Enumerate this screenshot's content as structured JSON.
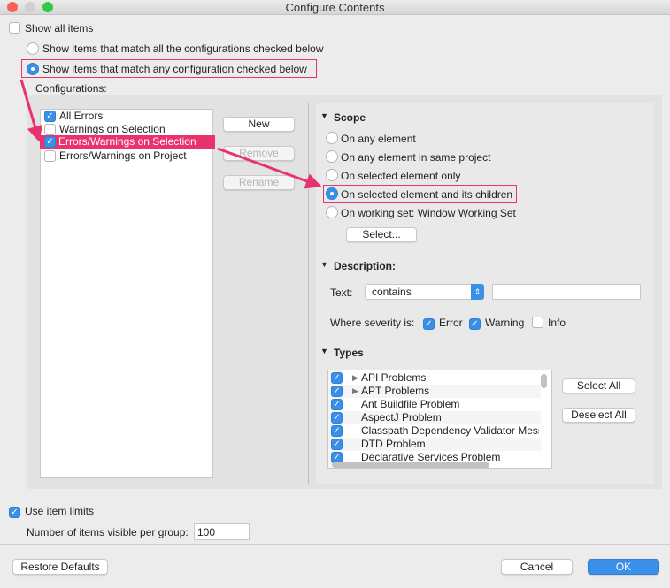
{
  "window": {
    "title": "Configure Contents"
  },
  "show_all": {
    "label": "Show all items",
    "checked": false
  },
  "match_all": {
    "label": "Show items that match all the configurations checked below",
    "selected": false
  },
  "match_any": {
    "label": "Show items that match any configuration checked below",
    "selected": true
  },
  "configurations": {
    "label": "Configurations:",
    "items": [
      {
        "label": "All Errors",
        "checked": true
      },
      {
        "label": "Warnings on Selection",
        "checked": false
      },
      {
        "label": "Errors/Warnings on Selection",
        "checked": true,
        "selected": true
      },
      {
        "label": "Errors/Warnings on Project",
        "checked": false
      }
    ],
    "new": "New",
    "remove": "Remove",
    "rename": "Rename"
  },
  "scope": {
    "title": "Scope",
    "options": [
      "On any element",
      "On any element in same project",
      "On selected element only",
      "On selected element and its children",
      "On working set:  Window Working Set"
    ],
    "selected": 3,
    "select_button": "Select..."
  },
  "description": {
    "title": "Description:",
    "text_label": "Text:",
    "operator": "contains",
    "value": "",
    "severity_label": "Where severity is:",
    "error": "Error",
    "warning": "Warning",
    "info": "Info",
    "error_checked": true,
    "warning_checked": true,
    "info_checked": false
  },
  "types": {
    "title": "Types",
    "items": [
      {
        "label": "API Problems",
        "expandable": true
      },
      {
        "label": "APT Problems",
        "expandable": true
      },
      {
        "label": "Ant Buildfile Problem"
      },
      {
        "label": "AspectJ Problem"
      },
      {
        "label": "Classpath Dependency Validator Mess"
      },
      {
        "label": "DTD Problem"
      },
      {
        "label": "Declarative Services Problem"
      }
    ],
    "select_all": "Select All",
    "deselect_all": "Deselect All"
  },
  "limits": {
    "label": "Use item limits",
    "checked": true,
    "per_group_label": "Number of items visible per group:",
    "per_group_value": "100"
  },
  "footer": {
    "restore": "Restore Defaults",
    "cancel": "Cancel",
    "ok": "OK"
  },
  "colors": {
    "accent": "#3a8fe8",
    "annotation": "#e8336d"
  }
}
